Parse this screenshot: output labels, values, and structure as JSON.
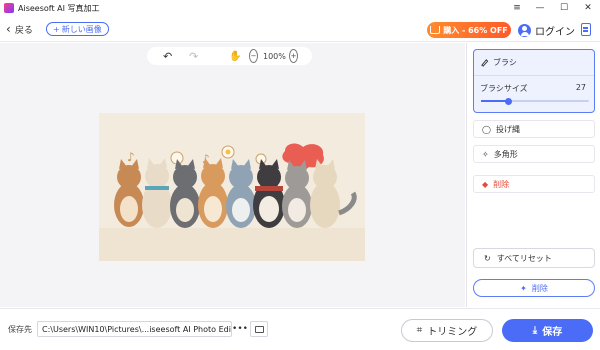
{
  "window": {
    "title": "Aiseesoft AI 写真加工",
    "minimize": "—",
    "maximize": "☐",
    "close": "✕",
    "menu": "≡"
  },
  "toolbar": {
    "back_label": "戻る",
    "new_image_label": "新しい画像",
    "buy_label": "購入 - 66% OFF",
    "login_label": "ログイン"
  },
  "canvas": {
    "zoom": "100%"
  },
  "panel": {
    "brush_label": "ブラシ",
    "brush_size_label": "ブラシサイズ",
    "brush_size_value": "27",
    "brush_size_fraction": 0.25,
    "lasso_label": "投げ縄",
    "polygon_label": "多角形",
    "erase_label": "削除",
    "reset_label": "すべてリセット",
    "remove_label": "削除"
  },
  "bottom": {
    "save_to_label": "保存先",
    "path": "C:\\Users\\WIN10\\Pictures\\...iseesoft AI Photo Editor",
    "more": "•••",
    "crop_label": "トリミング",
    "save_label": "保存"
  },
  "colors": {
    "accent": "#4a6cf7",
    "buy_orange": "#ff6a2c",
    "erase_red": "#e84a3a"
  }
}
